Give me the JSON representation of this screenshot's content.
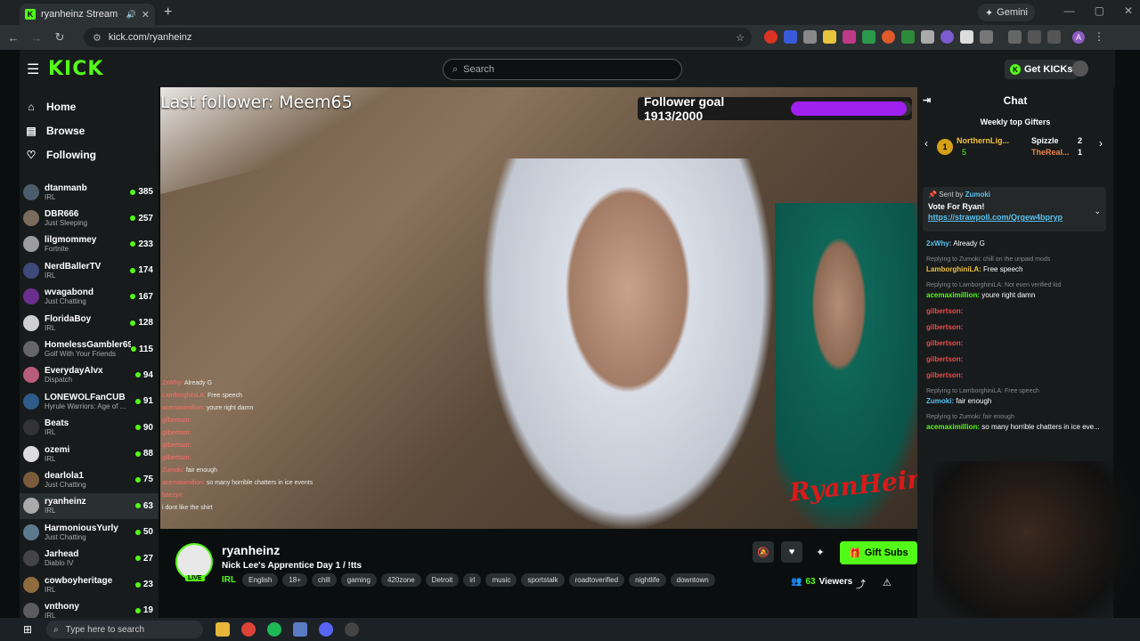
{
  "browser": {
    "tab_title": "ryanheinz Stream - Watch L",
    "tab_favicon": "K",
    "gemini_label": "Gemini",
    "url": "kick.com/ryanheinz",
    "profile_initial": "A"
  },
  "kick": {
    "logo": "KICK",
    "search_placeholder": "Search",
    "get_kicks": "Get KICKs"
  },
  "sidebar": {
    "nav": [
      {
        "label": "Home",
        "icon": "home-icon"
      },
      {
        "label": "Browse",
        "icon": "browse-icon"
      },
      {
        "label": "Following",
        "icon": "heart-icon"
      }
    ],
    "channels": [
      {
        "name": "dtanmanb",
        "category": "IRL",
        "viewers": "385",
        "color": "#4b5d6b"
      },
      {
        "name": "DBR666",
        "category": "Just Sleeping",
        "viewers": "257",
        "color": "#7a6b5c"
      },
      {
        "name": "lilgmommey",
        "category": "Fortnite",
        "viewers": "233",
        "color": "#9c9c9c"
      },
      {
        "name": "NerdBallerTV",
        "category": "IRL",
        "viewers": "174",
        "color": "#3d4a7a"
      },
      {
        "name": "wvagabond",
        "category": "Just Chatting",
        "viewers": "167",
        "color": "#6a2f8e"
      },
      {
        "name": "FloridaBoy",
        "category": "IRL",
        "viewers": "128",
        "color": "#cfcfcf"
      },
      {
        "name": "HomelessGambler69",
        "category": "Golf With Your Friends",
        "viewers": "115",
        "color": "#666"
      },
      {
        "name": "EverydayAlvx",
        "category": "Dispatch",
        "viewers": "94",
        "color": "#b85c7a"
      },
      {
        "name": "LONEWOLFanCUB",
        "category": "Hyrule Warriors: Age of ...",
        "viewers": "91",
        "color": "#2e5c8a"
      },
      {
        "name": "Beats",
        "category": "IRL",
        "viewers": "90",
        "color": "#333"
      },
      {
        "name": "ozemi",
        "category": "IRL",
        "viewers": "88",
        "color": "#ddd"
      },
      {
        "name": "dearlola1",
        "category": "Just Chatting",
        "viewers": "75",
        "color": "#7a5c3d"
      },
      {
        "name": "ryanheinz",
        "category": "IRL",
        "viewers": "63",
        "color": "#aaa"
      },
      {
        "name": "HarmoniousYurly",
        "category": "Just Chatting",
        "viewers": "50",
        "color": "#5c7a8e"
      },
      {
        "name": "Jarhead",
        "category": "Diablo IV",
        "viewers": "27",
        "color": "#444"
      },
      {
        "name": "cowboyheritage",
        "category": "IRL",
        "viewers": "23",
        "color": "#8e6a3d"
      },
      {
        "name": "vnthony",
        "category": "IRL",
        "viewers": "19",
        "color": "#5c5c5c"
      }
    ]
  },
  "video": {
    "last_follower": "Last follower: Meem65",
    "follower_goal": "Follower goal 1913/2000",
    "goal_fraction": 0.9565,
    "watermark": "RyanHeinz",
    "overlay_chat": [
      {
        "user": "2xWhy:",
        "text": "Already G"
      },
      {
        "user": "LamborghiniLA:",
        "text": "Free speech"
      },
      {
        "user": "acemaximillion:",
        "text": "youre right damn"
      },
      {
        "user": "gilbertson:",
        "text": ""
      },
      {
        "user": "gilbertson:",
        "text": ""
      },
      {
        "user": "gilbertson:",
        "text": ""
      },
      {
        "user": "gilbertson:",
        "text": ""
      },
      {
        "user": "Zumoki:",
        "text": "fair enough"
      },
      {
        "user": "acemaximillion:",
        "text": "so many horrible chatters in ice events"
      },
      {
        "user": "baezyx:",
        "text": ""
      },
      {
        "user": "",
        "text": "i dont like the shirt"
      }
    ]
  },
  "stream": {
    "channel": "ryanheinz",
    "live": "LIVE",
    "title": "Nick Lee's Apprentice Day 1 / !tts",
    "category": "IRL",
    "tags": [
      "English",
      "18+",
      "chill",
      "gaming",
      "420zone",
      "Detroit",
      "irl",
      "music",
      "sportstalk",
      "roadtoverified",
      "nightlife",
      "downtown"
    ],
    "gift_label": "Gift Subs",
    "viewers": "63",
    "viewers_label": "Viewers"
  },
  "chat": {
    "title": "Chat",
    "weekly_gifters_title": "Weekly top Gifters",
    "gifters": [
      {
        "name": "NorthernLig...",
        "count": "5"
      },
      {
        "name": "Spizzle",
        "count": "2"
      },
      {
        "name": "TheReal...",
        "count": "1"
      }
    ],
    "pinned_sent_by": "Sent by",
    "pinned_user": "Zumoki",
    "pinned_text": "Vote For Ryan!",
    "pinned_link": "https://strawpoll.com/Qrgew4bpryp",
    "messages": [
      {
        "reply": "",
        "user": "2xWhy:",
        "text": "Already G",
        "color": "#5bc0eb"
      },
      {
        "reply": "Replying to Zumoki: chill on the unpaid mods",
        "user": "LamborghiniLA:",
        "text": "Free speech",
        "color": "#f0c040"
      },
      {
        "reply": "Replying to LamborghiniLA: Not even verified kid",
        "user": "acemaximillion:",
        "text": "youre right damn",
        "color": "#53fc18"
      },
      {
        "reply": "",
        "user": "gilbertson:",
        "text": "",
        "color": "#e84c4c"
      },
      {
        "reply": "",
        "user": "gilbertson:",
        "text": "",
        "color": "#e84c4c"
      },
      {
        "reply": "",
        "user": "gilbertson:",
        "text": "",
        "color": "#e84c4c"
      },
      {
        "reply": "",
        "user": "gilbertson:",
        "text": "",
        "color": "#e84c4c"
      },
      {
        "reply": "",
        "user": "gilbertson:",
        "text": "",
        "color": "#e84c4c"
      },
      {
        "reply": "Replying to LamborghiniLA: Free speech",
        "user": "Zumoki:",
        "text": "fair enough",
        "color": "#5bc0eb"
      },
      {
        "reply": "Replying to Zumoki: fair enough",
        "user": "acemaximillion:",
        "text": "so many horrible chatters in ice eve...",
        "color": "#53fc18"
      }
    ]
  },
  "taskbar": {
    "search_placeholder": "Type here to search"
  }
}
